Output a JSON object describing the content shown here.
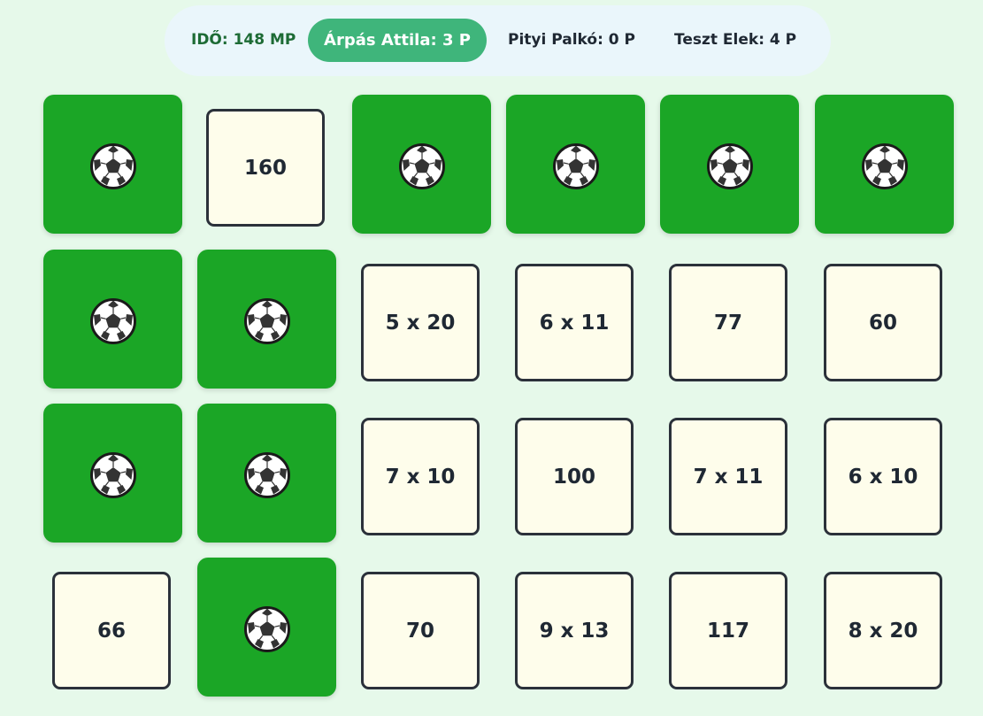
{
  "scoreboard": {
    "timer": "IDŐ: 148 MP",
    "players": [
      {
        "label": "Árpás Attila: 3 P",
        "active": true
      },
      {
        "label": "Pityi Palkó: 0 P",
        "active": false
      },
      {
        "label": "Teszt Elek: 4 P",
        "active": false
      }
    ]
  },
  "colors": {
    "card_back": "#1ba626",
    "card_face": "#fefdeb",
    "active_player": "#3fb57b",
    "background": "#e6f9ea"
  },
  "cards": [
    [
      "ball",
      "160",
      "ball",
      "ball",
      "ball",
      "ball"
    ],
    [
      "ball",
      "ball",
      "5 x 20",
      "6 x 11",
      "77",
      "60"
    ],
    [
      "ball",
      "ball",
      "7 x 10",
      "100",
      "7 x 11",
      "6 x 10"
    ],
    [
      "66",
      "ball",
      "70",
      "9 x 13",
      "117",
      "8 x 20"
    ]
  ],
  "card_back_icon": "soccer-ball-icon"
}
